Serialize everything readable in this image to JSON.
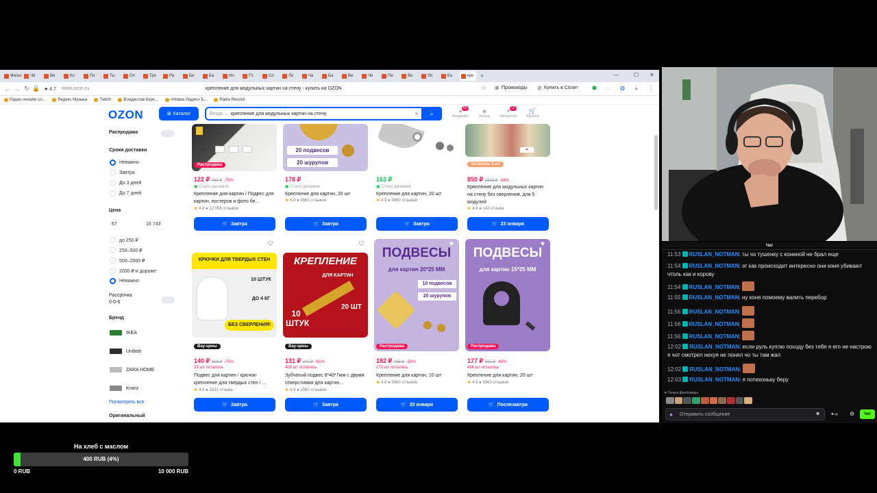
{
  "browser": {
    "tabs": [
      "Фильмы",
      "Чё",
      "Ве",
      "Ко",
      "Пэ",
      "Ты",
      "Оп",
      "Тро",
      "Ра",
      "Би",
      "Ба",
      "Ил",
      "F1",
      "Сп",
      "Ло",
      "Ча",
      "Ба",
      "Ве",
      "Че",
      "Пе",
      "Be",
      "Sti",
      "Ка",
      "кре"
    ],
    "active_tab": "кре",
    "address_url": "www.ozon.ru",
    "rating_badge": "4.7",
    "page_title": "крепление для модульных картин на стену - купить на OZON",
    "promocodes": "Промокоды",
    "buy_split": "Купить в Сплит",
    "bookmarks": [
      "Радио онлайн сл...",
      "Яндекс Музыка",
      "Twitch",
      "Владислав Кирк...",
      "«Новое Радио» Б...",
      "Radio Record"
    ]
  },
  "ozon": {
    "logo": "OZON",
    "catalog": "Каталог",
    "search_scope": "Везде",
    "search_query": "крепление для модульных картин на стену",
    "header": {
      "orders": {
        "label": "Входящие",
        "count": "63"
      },
      "favorites": {
        "label": "Заказы"
      },
      "cart": {
        "label": "Избранное",
        "count": "12"
      },
      "profile": {
        "label": "Корзина"
      }
    }
  },
  "filters": {
    "sale": "Распродажа",
    "delivery_title": "Сроки доставки",
    "delivery_options": [
      "Неважно",
      "Завтра",
      "До 3 дней",
      "До 7 дней"
    ],
    "price_title": "Цена",
    "price_min": "67",
    "price_max": "16 743",
    "price_options": [
      "до 250 ₽",
      "250–500 ₽",
      "500–2000 ₽",
      "2000 ₽ и дороже",
      "Неважно"
    ],
    "installment": "Рассрочка",
    "installment_sub": "0-0-6",
    "brand_title": "Бренд",
    "brands": [
      "IKEA",
      "Unibob",
      "ZARA HOME",
      "Kranz"
    ],
    "see_all": "Посмотреть все",
    "original": "Оригинальный"
  },
  "products_row1": [
    {
      "badge": "Распродажа",
      "price": "122 ₽",
      "old": "489 ₽",
      "disc": "-75%",
      "sub": "Стало дешевле",
      "title": "Крепление для картин / Подвес для картин, постеров и фото бе...",
      "rating": "4.8",
      "reviews": "12 056 отзывов",
      "btn": "Завтра"
    },
    {
      "badge": "",
      "price": "178 ₽",
      "old": "",
      "disc": "",
      "sub": "Стало дешевле",
      "title": "Крепление для картин, 20 шт",
      "rating": "4.9",
      "reviews": "9960 отзывов",
      "btn": "Завтра",
      "img_lines": [
        "20 подвесов",
        "20 шурупов"
      ]
    },
    {
      "badge": "",
      "price": "163 ₽",
      "old": "",
      "disc": "",
      "sub": "Стало дешевле",
      "title": "Крепление для картин, 20 шт",
      "rating": "4.9",
      "reviews": "9960 отзывов",
      "btn": "Завтра"
    },
    {
      "badge": "Осталось 5 шт",
      "price": "850 ₽",
      "old": "2819 ₽",
      "disc": "-68%",
      "sub": "",
      "title": "Крепление для модульных картин на стену без сверления, для 5 модулей",
      "rating": "4.8",
      "reviews": "142 отзыва",
      "btn": "23 января"
    }
  ],
  "products_row2": [
    {
      "badge": "Вау-цены",
      "price": "140 ₽",
      "old": "598 ₽",
      "disc": "-75%",
      "sub": "29 шт осталось",
      "title": "Подвес для картин / крючок-крепление для твердых стен / ...",
      "rating": "4.8",
      "reviews": "1632 отзыва",
      "btn": "Завтра",
      "img_lines": [
        "КРЮЧКИ ДЛЯ ТВЕРДЫХ СТЕН",
        "10 ШТУК",
        "ДО 4 КГ",
        "БЕЗ СВЕРЛЕНИЯ!"
      ]
    },
    {
      "badge": "Вау-цены",
      "price": "131 ₽",
      "old": "340 ₽",
      "disc": "-61%",
      "sub": "406 шт осталось",
      "title": "Зубчатый подвес 8*40*7мм с двумя отверстиями для картин...",
      "rating": "4.9",
      "reviews": "1560 отзывов",
      "btn": "Завтра",
      "img_lines": [
        "КРЕПЛЕНИЕ",
        "ДЛЯ КАРТИН",
        "10 ШТУК",
        "20 ШТ"
      ]
    },
    {
      "badge": "Распродажа",
      "price": "182 ₽",
      "old": "435 ₽",
      "disc": "-58%",
      "sub": "273 шт осталось",
      "title": "Крепление для картин, 10 шт",
      "rating": "4.9",
      "reviews": "9960 отзывов",
      "btn": "20 января",
      "img_lines": [
        "ПОДВЕСЫ",
        "для картин 20*25 ММ",
        "10 подвесов",
        "20 шурупов"
      ]
    },
    {
      "badge": "Распродажа",
      "price": "177 ₽",
      "old": "550 ₽",
      "disc": "-68%",
      "sub": "496 шт осталось",
      "title": "Крепление для картин, 20 шт",
      "rating": "4.9",
      "reviews": "9960 отзывов",
      "btn": "Послезавтра",
      "img_lines": [
        "ПОДВЕСЫ",
        "для картин 15*25 ММ"
      ]
    }
  ],
  "chat": {
    "header": "Чат",
    "messages": [
      {
        "time": "11:53",
        "user": "RUSLAN_NOTMAN",
        "text": ": ты чо тушенку с кониной не брал еще",
        "emote": false
      },
      {
        "time": "11:54",
        "user": "RUSLAN_NOTMAN",
        "text": ": эт как происходит интересно они коня убивают чтоль как и корову",
        "emote": false
      },
      {
        "time": "11:54",
        "user": "RUSLAN_NOTMAN",
        "text": ":",
        "emote": true
      },
      {
        "time": "11:55",
        "user": "RUSLAN_NOTMAN",
        "text": ": ну коня помоему валить перебор",
        "emote": false
      },
      {
        "time": "11:56",
        "user": "RUSLAN_NOTMAN",
        "text": ":",
        "emote": true
      },
      {
        "time": "11:56",
        "user": "RUSLAN_NOTMAN",
        "text": ":",
        "emote": true
      },
      {
        "time": "11:56",
        "user": "RUSLAN_NOTMAN",
        "text": ":",
        "emote": true
      },
      {
        "time": "12:02",
        "user": "RUSLAN_NOTMAN",
        "text": ": если руль куплю походу без тебя я его не настрою я чот смотрел нехуя не понял чо ты там жал",
        "emote": false
      },
      {
        "time": "12:02",
        "user": "RUSLAN_NOTMAN",
        "text": ":",
        "emote": true
      },
      {
        "time": "12:03",
        "user": "RUSLAN_NOTMAN",
        "text": ": я потихоньку беру",
        "emote": false
      }
    ],
    "followers_only": "Только фолловеры",
    "input_placeholder": "Отправить сообщение",
    "send": "Чат"
  },
  "donation": {
    "title": "На хлеб с маслом",
    "value_text": "400 RUB (4%)",
    "progress_percent": 4,
    "min": "0 RUB",
    "max": "10 000 RUB"
  }
}
